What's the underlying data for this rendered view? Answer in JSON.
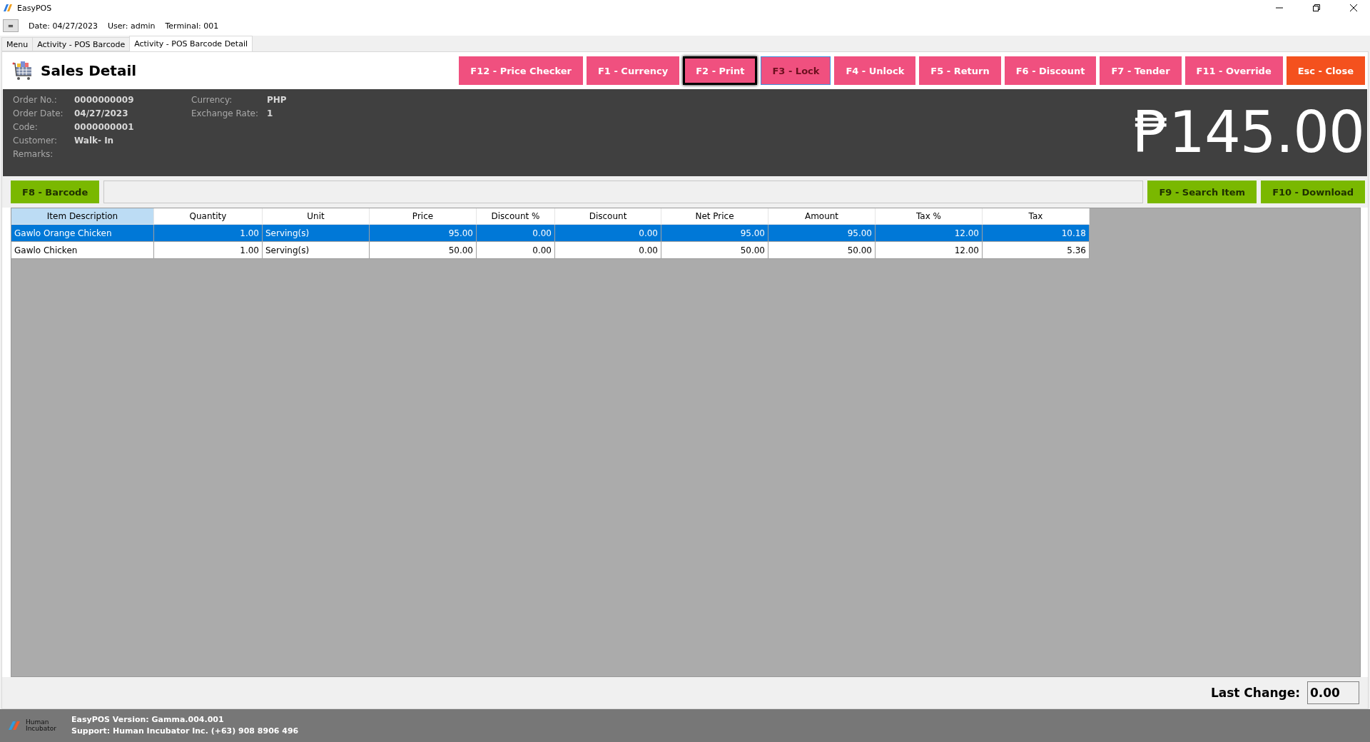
{
  "window": {
    "title": "EasyPOS"
  },
  "info_bar": {
    "menu_button": "=",
    "items": [
      "Date: 04/27/2023",
      "User: admin",
      "Terminal: 001"
    ]
  },
  "tabs": [
    {
      "label": "Menu",
      "selected": false
    },
    {
      "label": "Activity - POS Barcode",
      "selected": false
    },
    {
      "label": "Activity - POS Barcode Detail",
      "selected": true
    }
  ],
  "page_title": "Sales Detail",
  "toolbar": [
    {
      "label": "F12 - Price Checker",
      "kind": "action",
      "focused": false,
      "hovered": false
    },
    {
      "label": "F1 - Currency",
      "kind": "action",
      "focused": false,
      "hovered": false
    },
    {
      "label": "F2 - Print",
      "kind": "action",
      "focused": true,
      "hovered": false
    },
    {
      "label": "F3 - Lock",
      "kind": "action",
      "focused": false,
      "hovered": true
    },
    {
      "label": "F4 - Unlock",
      "kind": "action",
      "focused": false,
      "hovered": false
    },
    {
      "label": "F5 - Return",
      "kind": "action",
      "focused": false,
      "hovered": false
    },
    {
      "label": "F6 - Discount",
      "kind": "action",
      "focused": false,
      "hovered": false
    },
    {
      "label": "F7 - Tender",
      "kind": "action",
      "focused": false,
      "hovered": false
    },
    {
      "label": "F11 - Override",
      "kind": "action",
      "focused": false,
      "hovered": false
    },
    {
      "label": "Esc - Close",
      "kind": "close",
      "focused": false,
      "hovered": false
    }
  ],
  "summary": {
    "left": [
      {
        "label": "Order No.:",
        "value": "0000000009"
      },
      {
        "label": "Order Date:",
        "value": "04/27/2023"
      },
      {
        "label": "Code:",
        "value": "0000000001"
      },
      {
        "label": "Customer:",
        "value": "Walk- In"
      },
      {
        "label": "Remarks:"
      }
    ],
    "right": [
      {
        "label": "Currency:",
        "value": "PHP"
      },
      {
        "label": "Exchange Rate:",
        "value": "1"
      }
    ],
    "total": "₱145.00"
  },
  "barcode_bar": {
    "barcode_button": "F8 - Barcode",
    "buttons": [
      "F9 - Search Item",
      "F10 - Download"
    ]
  },
  "table": {
    "columns": [
      {
        "label": "Item Description",
        "kind": "text",
        "selected": true
      },
      {
        "label": "Quantity",
        "kind": "number",
        "selected": false
      },
      {
        "label": "Unit",
        "kind": "text",
        "selected": false
      },
      {
        "label": "Price",
        "kind": "number",
        "selected": false
      },
      {
        "label": "Discount %",
        "kind": "number",
        "selected": false
      },
      {
        "label": "Discount",
        "kind": "number",
        "selected": false
      },
      {
        "label": "Net Price",
        "kind": "number",
        "selected": false
      },
      {
        "label": "Amount",
        "kind": "number",
        "selected": false
      },
      {
        "label": "Tax %",
        "kind": "number",
        "selected": false
      },
      {
        "label": "Tax",
        "kind": "number",
        "selected": false
      }
    ],
    "rows": [
      {
        "selected": true,
        "cells": [
          "Gawlo Orange Chicken",
          "1.00",
          "Serving(s)",
          "95.00",
          "0.00",
          "0.00",
          "95.00",
          "95.00",
          "12.00",
          "10.18"
        ]
      },
      {
        "selected": false,
        "cells": [
          "Gawlo Chicken",
          "1.00",
          "Serving(s)",
          "50.00",
          "0.00",
          "0.00",
          "50.00",
          "50.00",
          "12.00",
          "5.36"
        ]
      }
    ]
  },
  "last_change": {
    "label": "Last Change:",
    "value": "0.00"
  },
  "status_bar": {
    "lines": [
      "EasyPOS Version: Gamma.004.001",
      "Support: Human Incubator Inc. (+63) 908 8906 496"
    ],
    "logo_text": "Human Incubator"
  }
}
